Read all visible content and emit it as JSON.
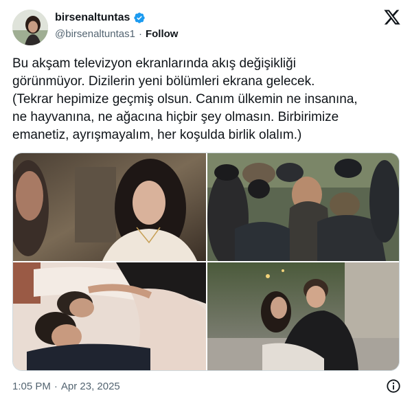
{
  "author": {
    "display_name": "birsenaltuntas",
    "handle": "@birsenaltuntas1",
    "separator": "·",
    "follow_label": "Follow",
    "verified_icon": "verified-badge-icon"
  },
  "brand_icon": "x-logo-icon",
  "tweet": {
    "text": "Bu akşam televizyon ekranlarında akış değişikliği\ngörünmüyor. Dizilerin yeni bölümleri ekrana gelecek.\n(Tekrar hepimize geçmiş olsun. Canım ülkemin ne insanına,\nne hayvanına, ne ağacına hiçbir şey olmasın. Birbirimize\nemanetiz, ayrışmayalım, her koşulda birlik olalım.)"
  },
  "media": {
    "count": 4,
    "images": [
      "woman-portrait-scene",
      "masked-warriors-scene",
      "couple-lying-in-bed-scene",
      "couple-embracing-street-scene"
    ]
  },
  "footer": {
    "time": "1:05 PM",
    "separator": "·",
    "date": "Apr 23, 2025",
    "info_icon": "info-icon"
  },
  "colors": {
    "text": "#0f1419",
    "secondary": "#536471",
    "verified": "#1d9bf0",
    "border": "#cfd9de"
  }
}
